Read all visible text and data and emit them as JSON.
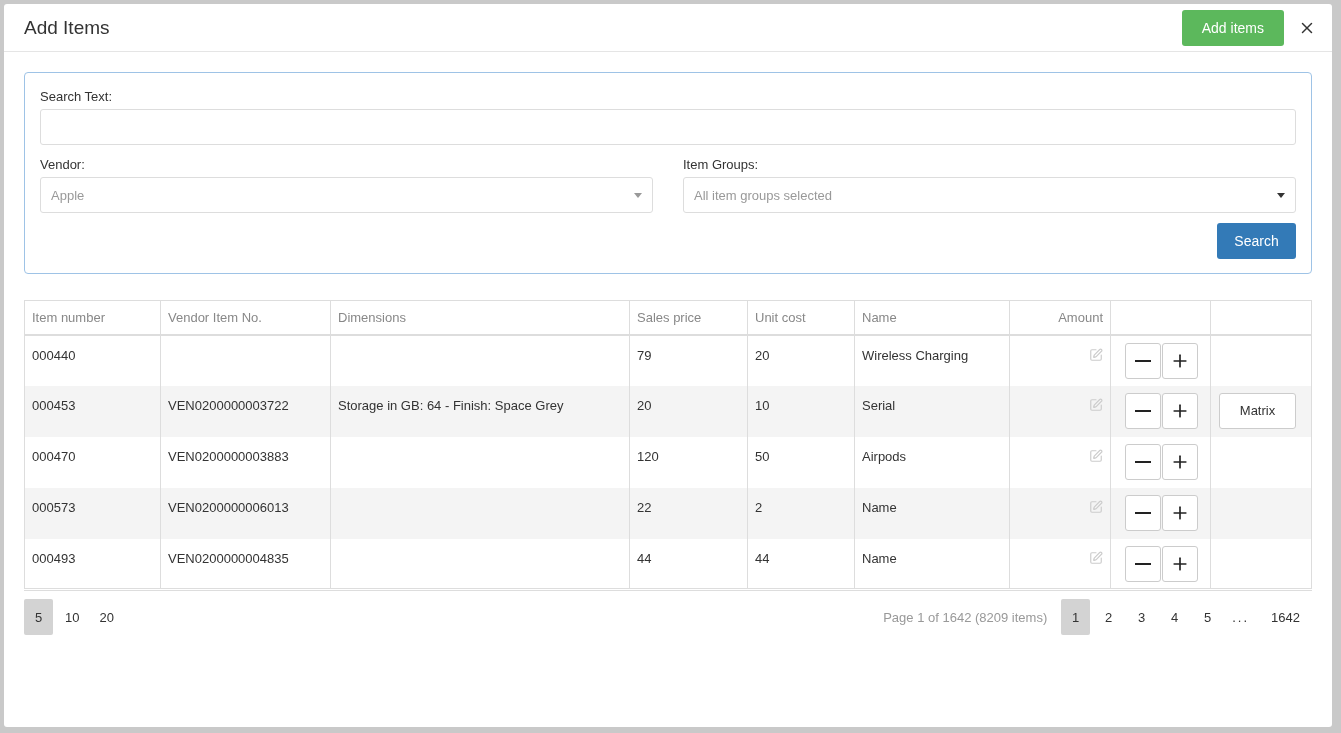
{
  "dialog": {
    "title": "Add Items",
    "add_button": "Add items"
  },
  "filters": {
    "search_label": "Search Text:",
    "vendor_label": "Vendor:",
    "vendor_placeholder": "Apple",
    "groups_label": "Item Groups:",
    "groups_placeholder": "All item groups selected",
    "search_button": "Search"
  },
  "table": {
    "columns": [
      "Item number",
      "Vendor Item No.",
      "Dimensions",
      "Sales price",
      "Unit cost",
      "Name",
      "Amount"
    ],
    "rows": [
      {
        "item_number": "000440",
        "vendor_item_no": "",
        "dimensions": "",
        "sales_price": "79",
        "unit_cost": "20",
        "name": "Wireless Charging"
      },
      {
        "item_number": "000453",
        "vendor_item_no": "VEN0200000003722",
        "dimensions": "Storage in GB: 64 - Finish: Space Grey",
        "sales_price": "20",
        "unit_cost": "10",
        "name": "Serial",
        "matrix_button": "Matrix"
      },
      {
        "item_number": "000470",
        "vendor_item_no": "VEN0200000003883",
        "dimensions": "",
        "sales_price": "120",
        "unit_cost": "50",
        "name": "Airpods"
      },
      {
        "item_number": "000573",
        "vendor_item_no": "VEN0200000006013",
        "dimensions": "",
        "sales_price": "22",
        "unit_cost": "2",
        "name": "Name"
      },
      {
        "item_number": "000493",
        "vendor_item_no": "VEN0200000004835",
        "dimensions": "",
        "sales_price": "44",
        "unit_cost": "44",
        "name": "Name"
      }
    ]
  },
  "pagination": {
    "page_sizes": [
      {
        "label": "5",
        "selected": true
      },
      {
        "label": "10",
        "selected": false
      },
      {
        "label": "20",
        "selected": false
      }
    ],
    "summary": "Page 1 of 1642 (8209 items)",
    "pages": [
      {
        "label": "1",
        "selected": true
      },
      {
        "label": "2",
        "selected": false
      },
      {
        "label": "3",
        "selected": false
      },
      {
        "label": "4",
        "selected": false
      },
      {
        "label": "5",
        "selected": false
      }
    ],
    "ellipsis": "...",
    "last_page": "1642"
  }
}
